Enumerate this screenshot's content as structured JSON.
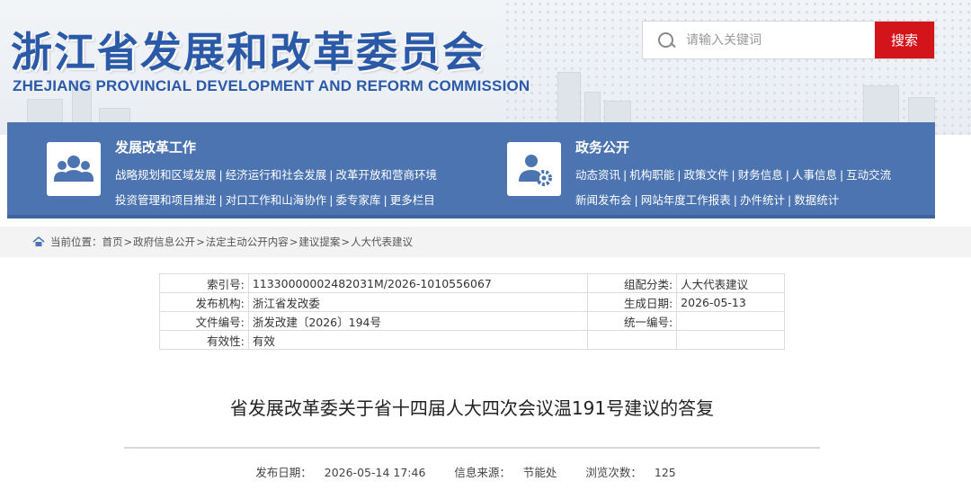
{
  "header": {
    "title": "浙江省发展和改革委员会",
    "subtitle": "ZHEJIANG PROVINCIAL DEVELOPMENT AND REFORM COMMISSION",
    "search_placeholder": "请输入关键词",
    "search_button": "搜索"
  },
  "nav": {
    "groups": [
      {
        "heading": "发展改革工作",
        "icon": "people-group-icon",
        "rows": [
          [
            "战略规划和区域发展",
            "经济运行和社会发展",
            "改革开放和营商环境"
          ],
          [
            "投资管理和项目推进",
            "对口工作和山海协作",
            "委专家库",
            "更多栏目"
          ]
        ]
      },
      {
        "heading": "政务公开",
        "icon": "user-gear-icon",
        "rows": [
          [
            "动态资讯",
            "机构职能",
            "政策文件",
            "财务信息",
            "人事信息",
            "互动交流"
          ],
          [
            "新闻发布会",
            "网站年度工作报表",
            "办件统计",
            "数据统计"
          ]
        ]
      }
    ],
    "separator": "|"
  },
  "breadcrumb": {
    "label": "当前位置：",
    "items": [
      "首页",
      "政府信息公开",
      "法定主动公开内容",
      "建议提案",
      "人大代表建议"
    ],
    "arrow": ">"
  },
  "info": {
    "rows": [
      {
        "k1": "索引号:",
        "v1": "11330000002482031M/2026-1010556067",
        "k2": "组配分类:",
        "v2": "人大代表建议"
      },
      {
        "k1": "发布机构:",
        "v1": "浙江省发改委",
        "k2": "生成日期:",
        "v2": "2026-05-13"
      },
      {
        "k1": "文件编号:",
        "v1": "浙发改建〔2026〕194号",
        "k2": "统一编号:",
        "v2": ""
      },
      {
        "k1": "有效性:",
        "v1": "有效",
        "k2": "",
        "v2": ""
      }
    ]
  },
  "article": {
    "title": "省发展改革委关于省十四届人大四次会议温191号建议的答复",
    "meta": {
      "date_label": "发布日期：",
      "date": "2026-05-14 17:46",
      "source_label": "信息来源：",
      "source": "节能处",
      "views_label": "浏览次数：",
      "views": "125"
    }
  },
  "colors": {
    "brand_blue": "#2a59a8",
    "nav_blue": "#4b74b0",
    "search_red": "#d4141b"
  }
}
